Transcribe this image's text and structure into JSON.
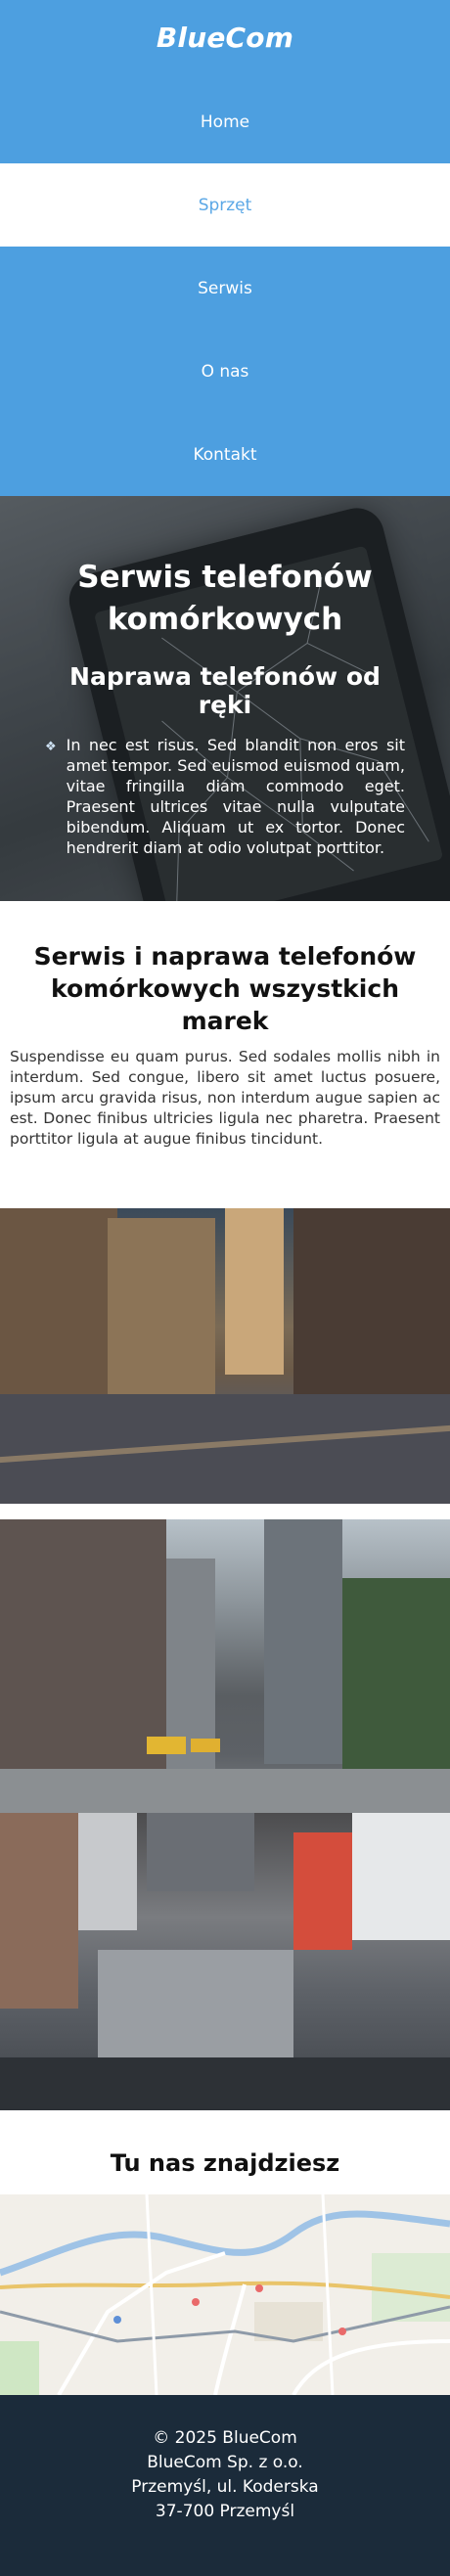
{
  "header": {
    "logo": "BlueCom"
  },
  "nav": {
    "items": [
      {
        "label": "Home"
      },
      {
        "label": "Sprzęt"
      },
      {
        "label": "Serwis"
      },
      {
        "label": "O nas"
      },
      {
        "label": "Kontakt"
      }
    ]
  },
  "hero": {
    "title": "Serwis telefonów komórkowych",
    "subtitle": "Naprawa telefonów od ręki",
    "items": [
      "In nec est risus. Sed blandit non eros sit amet tempor. Sed euismod euismod quam, vitae fringilla diam commodo eget. Praesent ultrices vitae nulla vulputate bibendum. Aliquam ut ex tortor. Donec hendrerit diam at odio volutpat porttitor."
    ]
  },
  "about": {
    "title": "Serwis i naprawa telefonów komórkowych wszystkich marek",
    "text": "Suspendisse eu quam purus. Sed sodales mollis nibh in interdum. Sed congue, libero sit amet luctus posuere, ipsum arcu gravida risus, non interdum augue sapien ac est. Donec finibus ultricies ligula nec pharetra. Praesent porttitor ligula at augue finibus tincidunt."
  },
  "map_section": {
    "title": "Tu nas znajdziesz"
  },
  "footer": {
    "line1": "© 2025 BlueCom",
    "line2": "BlueCom Sp. z o.o.",
    "line3": "Przemyśl, ul. Koderska",
    "line4": "37-700 Przemyśl"
  },
  "colors": {
    "primary": "#4d9fe0",
    "active_nav_text": "#5aa7e6",
    "footer_bg": "#1b2b3a"
  }
}
